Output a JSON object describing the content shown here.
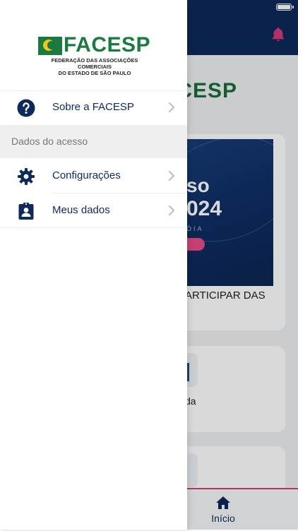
{
  "status_bar": {
    "battery": "full"
  },
  "background": {
    "logo_text": "FACESP",
    "logo_subtext": "FEDERAÇÃO DAS ASSOCIAÇÕES COMERCIAIS DO ESTADO DE SÃO PAULO",
    "banner_line1": "so",
    "banner_line2": "024",
    "banner_line3": "ÓIA",
    "card1_text": "ARTICIPAR DAS",
    "card2_text": "da",
    "tab_home_label": "Início",
    "accent_color": "#d43a7a"
  },
  "drawer": {
    "logo": {
      "word": "FACESP",
      "subtitle_line1": "FEDERAÇÃO DAS ASSOCIAÇÕES COMERCIAIS",
      "subtitle_line2": "DO ESTADO DE SÃO PAULO"
    },
    "items": [
      {
        "label": "Sobre a FACESP",
        "icon": "help-icon"
      },
      {
        "label": "Configurações",
        "icon": "gear-icon"
      },
      {
        "label": "Meus dados",
        "icon": "id-badge-icon"
      }
    ],
    "section_header": "Dados do acesso"
  },
  "colors": {
    "navy": "#0d2a5a",
    "green": "#1a7a3f",
    "pink": "#d43a7a"
  }
}
